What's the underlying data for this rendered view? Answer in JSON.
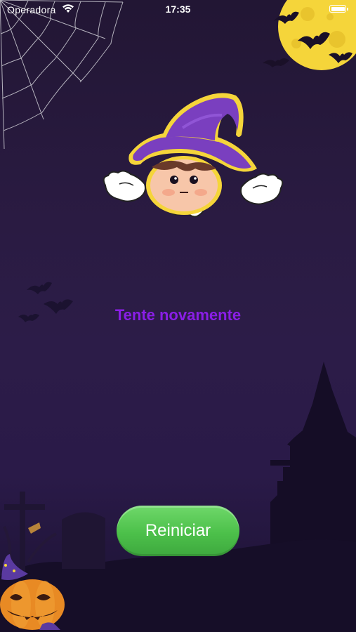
{
  "status_bar": {
    "carrier": "Operadora",
    "time": "17:35"
  },
  "icons": {
    "wifi": "wifi-icon",
    "battery": "battery-icon",
    "moon": "full-moon-with-bats",
    "web": "spider-web",
    "witch": "witch-hat-character",
    "castle": "haunted-castle",
    "pumpkin": "jack-o-lantern"
  },
  "colors": {
    "message": "#8a1ee6",
    "button": "#4cc04a",
    "moon": "#f5d53a",
    "hat": "#7a3fbf"
  },
  "main": {
    "message": "Tente novamente",
    "restart_button": "Reiniciar"
  }
}
